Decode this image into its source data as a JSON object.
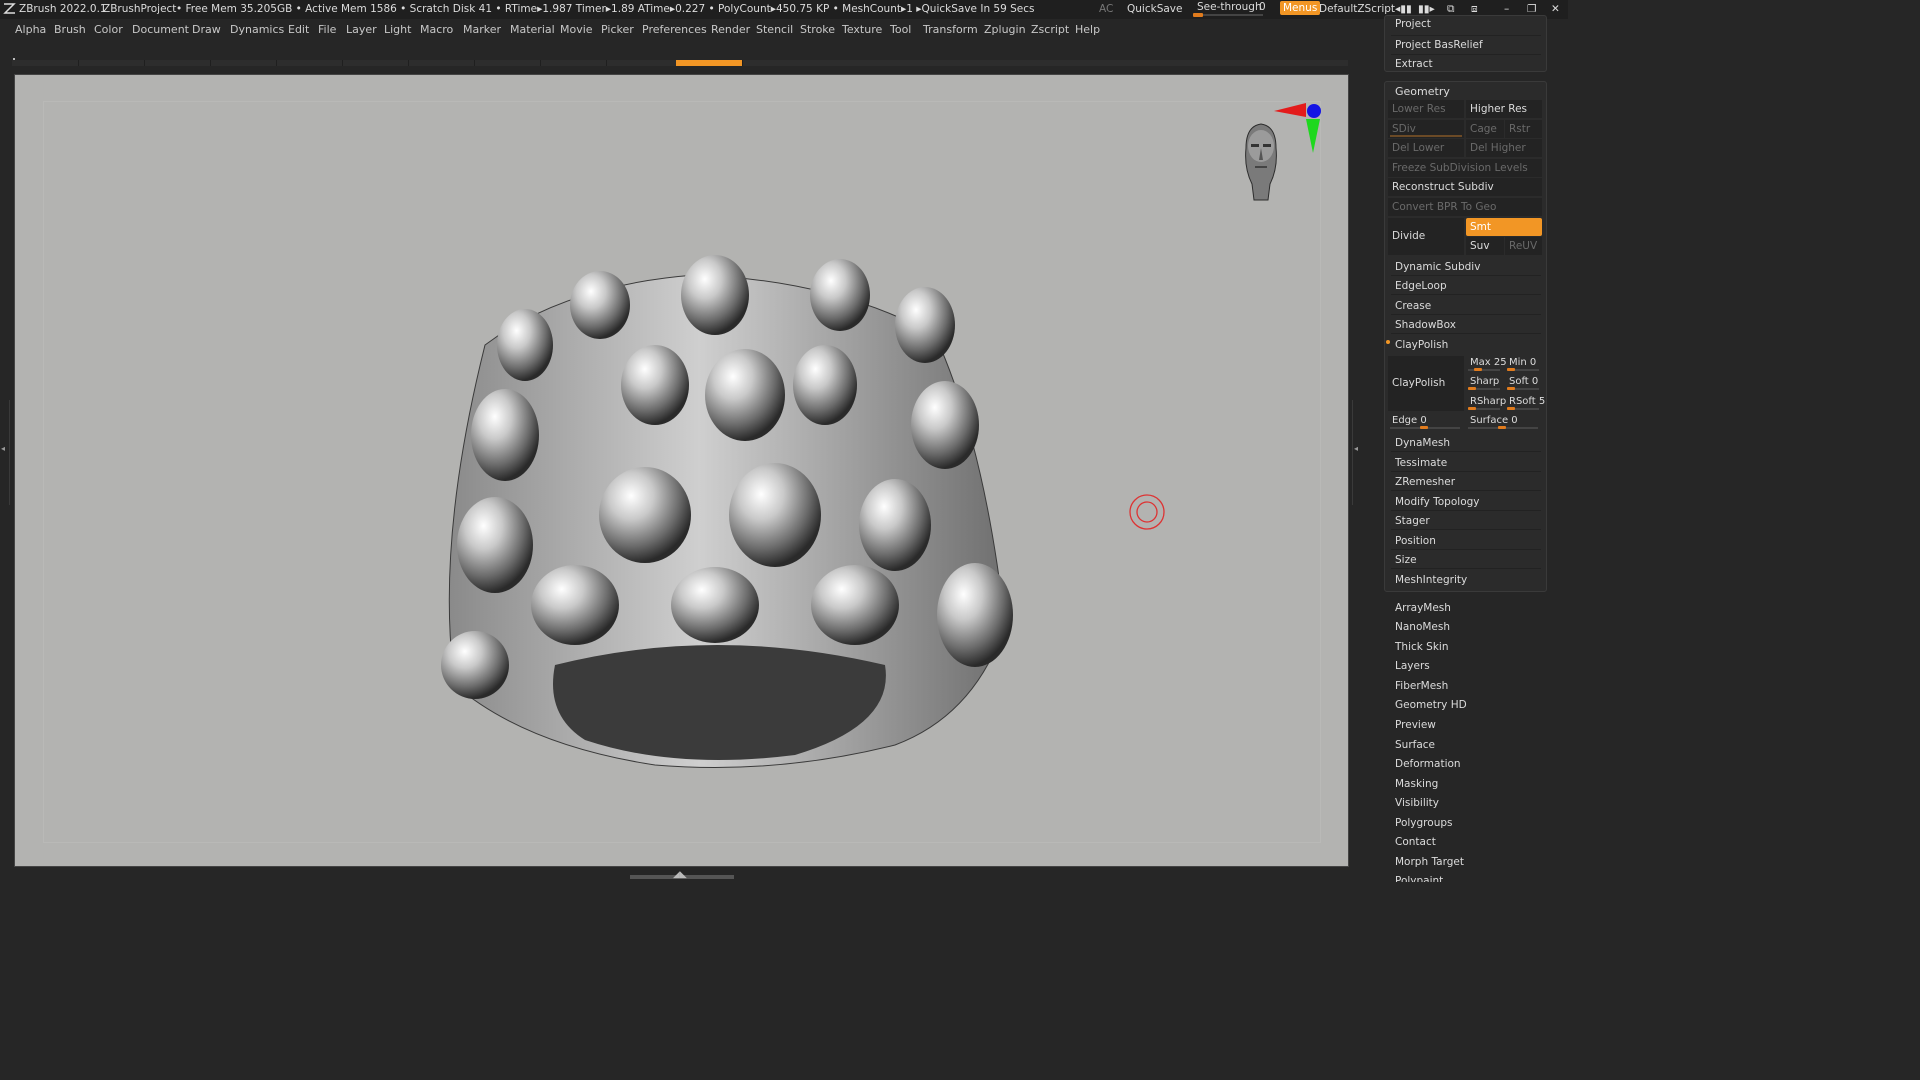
{
  "titlebar": {
    "app": "ZBrush 2022.0.1",
    "project": "ZBrushProject",
    "stats": "• Free Mem 35.205GB • Active Mem 1586 • Scratch Disk 41 •   RTime▸1.987 Timer▸1.89 ATime▸0.227 • PolyCount▸450.75 KP  • MeshCount▸1   ▸QuickSave In 59 Secs",
    "ac": "AC",
    "quicksave": "QuickSave",
    "see_through_label": "See-through",
    "see_through_value": "0",
    "menus": "Menus",
    "script": "DefaultZScript"
  },
  "menubar": {
    "items": [
      "Alpha",
      "Brush",
      "Color",
      "Document",
      "Draw",
      "Dynamics",
      "Edit",
      "File",
      "Layer",
      "Light",
      "Macro",
      "Marker",
      "Material",
      "Movie",
      "Picker",
      "Preferences",
      "Render",
      "Stencil",
      "Stroke",
      "Texture",
      "Tool",
      "Transform",
      "Zplugin",
      "Zscript",
      "Help"
    ]
  },
  "panel": {
    "top_items": [
      "Project",
      "Project BasRelief",
      "Extract"
    ],
    "geometry": {
      "title": "Geometry",
      "lower_res": "Lower Res",
      "higher_res": "Higher Res",
      "sdiv": "SDiv",
      "cage": "Cage",
      "rstr": "Rstr",
      "del_lower": "Del Lower",
      "del_higher": "Del Higher",
      "freeze": "Freeze SubDivision Levels",
      "reconstruct": "Reconstruct Subdiv",
      "convert": "Convert BPR To Geo",
      "divide": "Divide",
      "smt": "Smt",
      "suv": "Suv",
      "reuv": "ReUV",
      "items": [
        "Dynamic Subdiv",
        "EdgeLoop",
        "Crease",
        "ShadowBox"
      ],
      "claypolish_title": "ClayPolish",
      "claypolish_btn": "ClayPolish",
      "max": "Max 25",
      "min": "Min 0",
      "sharp": "Sharp",
      "soft": "Soft 0",
      "rsharp": "RSharp",
      "rsoft": "RSoft 5",
      "edge": "Edge 0",
      "surface": "Surface 0",
      "items2": [
        "DynaMesh",
        "Tessimate",
        "ZRemesher",
        "Modify Topology",
        "Stager",
        "Position",
        "Size",
        "MeshIntegrity"
      ]
    },
    "subpalettes": [
      "ArrayMesh",
      "NanoMesh",
      "Thick Skin",
      "Layers",
      "FiberMesh",
      "Geometry HD",
      "Preview",
      "Surface",
      "Deformation",
      "Masking",
      "Visibility",
      "Polygroups",
      "Contact",
      "Morph Target",
      "Polypaint"
    ]
  },
  "colors": {
    "accent": "#f29625",
    "viewport_bg": "#b3b3b1",
    "panel_bg": "#262626"
  }
}
